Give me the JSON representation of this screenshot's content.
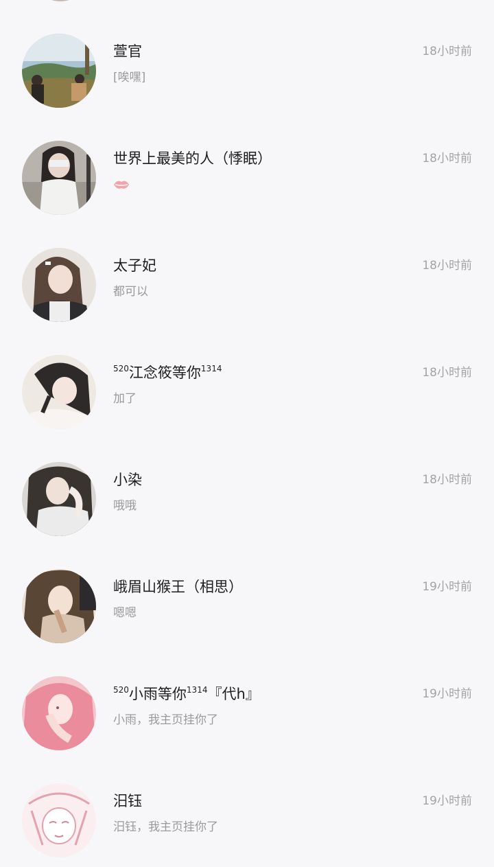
{
  "chats": [
    {
      "name": "萱官",
      "preview": "[唉嘿]",
      "time": "18小时前",
      "avatar_icon": "landscape-photo-avatar"
    },
    {
      "name": "世界上最美的人（悸眠）",
      "preview": "",
      "preview_icon": "lips-emoji",
      "time": "18小时前",
      "avatar_icon": "girl-photo-avatar"
    },
    {
      "name": "太子妃",
      "preview": "都可以",
      "time": "18小时前",
      "avatar_icon": "girl-photo-avatar"
    },
    {
      "name_prefix": "5",
      "name_prefix2": "2",
      "name_prefix3": "0",
      "name_main": "江念筱等你",
      "name_suffix": "1314",
      "preview": "加了",
      "time": "18小时前",
      "avatar_icon": "girl-photo-avatar"
    },
    {
      "name": "小染",
      "preview": "哦哦",
      "time": "18小时前",
      "avatar_icon": "girl-photo-avatar"
    },
    {
      "name": "峨眉山猴王（相思）",
      "preview": "嗯嗯",
      "time": "19小时前",
      "avatar_icon": "anime-boy-avatar"
    },
    {
      "name_prefix": "5",
      "name_prefix2": "2",
      "name_prefix3": "0",
      "name_main": "小雨等你",
      "name_suffix": "1314",
      "name_tail": "『代h』",
      "preview": "小雨，我主页挂你了",
      "time": "19小时前",
      "avatar_icon": "pink-hair-avatar"
    },
    {
      "name": "汨钰",
      "preview": "汨钰，我主页挂你了",
      "time": "19小时前",
      "avatar_icon": "anime-sketch-avatar"
    }
  ]
}
